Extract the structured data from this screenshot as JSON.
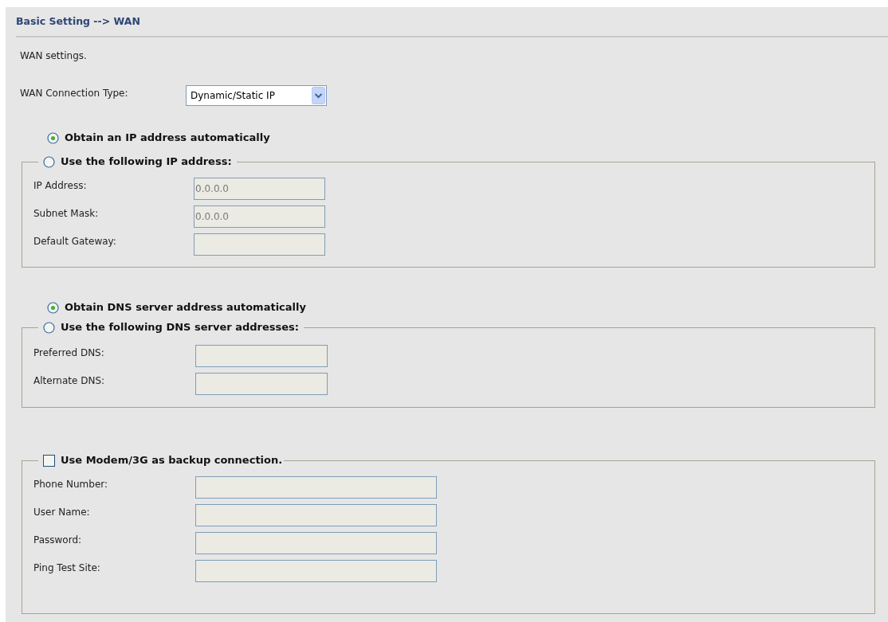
{
  "breadcrumb": "Basic Setting --> WAN",
  "description": "WAN settings.",
  "connection_type": {
    "label": "WAN Connection Type:",
    "value": "Dynamic/Static IP"
  },
  "ip": {
    "auto_option": {
      "label": "Obtain an IP address automatically",
      "selected": true
    },
    "manual_option": {
      "label": "Use the following IP address:",
      "selected": false
    },
    "fields": [
      {
        "label": "IP Address:",
        "value": "0.0.0.0",
        "disabled": true
      },
      {
        "label": "Subnet Mask:",
        "value": "0.0.0.0",
        "disabled": true
      },
      {
        "label": "Default Gateway:",
        "disabled": true
      }
    ]
  },
  "dns": {
    "auto_option": {
      "label": "Obtain DNS server address automatically",
      "selected": true
    },
    "manual_option": {
      "label": "Use the following DNS server addresses:",
      "selected": false
    },
    "fields": [
      {
        "label": "Preferred DNS:",
        "disabled": true
      },
      {
        "label": "Alternate DNS:",
        "disabled": true
      }
    ]
  },
  "backup": {
    "label": "Use Modem/3G as backup connection.",
    "checked": false,
    "fields": [
      {
        "label": "Phone Number:",
        "disabled": true
      },
      {
        "label": "User Name:",
        "disabled": true
      },
      {
        "label": "Password:",
        "disabled": true
      },
      {
        "label": "Ping Test Site:",
        "disabled": true
      }
    ]
  }
}
